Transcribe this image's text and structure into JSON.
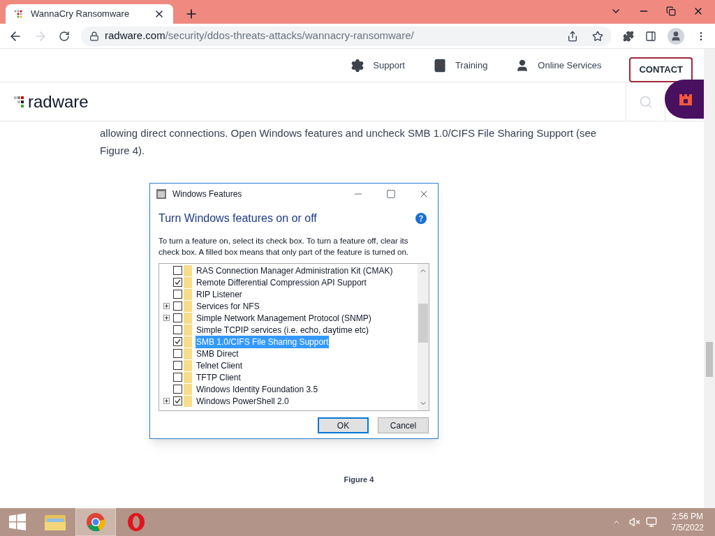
{
  "browser": {
    "tab": {
      "title": "WannaCry Ransomware"
    },
    "address": {
      "domain": "radware.com",
      "path": "/security/ddos-threats-attacks/wannacry-ransomware/"
    }
  },
  "site": {
    "nav": [
      {
        "kind": "gear",
        "label": "Support"
      },
      {
        "kind": "book",
        "label": "Training"
      },
      {
        "kind": "person",
        "label": "Online Services"
      }
    ],
    "contact": "CONTACT",
    "logo": "radware",
    "paragraph": "allowing direct connections. Open Windows features and uncheck SMB 1.0/CIFS File Sharing Support (see Figure 4).",
    "caption": "Figure 4"
  },
  "dialog": {
    "title": "Windows Features",
    "heading": "Turn Windows features on or off",
    "description": "To turn a feature on, select its check box. To turn a feature off, clear its check box. A filled box means that only part of the feature is turned on.",
    "features": [
      {
        "label": "RAS Connection Manager Administration Kit (CMAK)",
        "expandable": false,
        "checked": false,
        "selected": false
      },
      {
        "label": "Remote Differential Compression API Support",
        "expandable": false,
        "checked": true,
        "selected": false
      },
      {
        "label": "RIP Listener",
        "expandable": false,
        "checked": false,
        "selected": false
      },
      {
        "label": "Services for NFS",
        "expandable": true,
        "checked": false,
        "selected": false
      },
      {
        "label": "Simple Network Management Protocol (SNMP)",
        "expandable": true,
        "checked": false,
        "selected": false
      },
      {
        "label": "Simple TCPIP services (i.e. echo, daytime etc)",
        "expandable": false,
        "checked": false,
        "selected": false
      },
      {
        "label": "SMB 1.0/CIFS File Sharing Support",
        "expandable": false,
        "checked": true,
        "selected": true
      },
      {
        "label": "SMB Direct",
        "expandable": false,
        "checked": false,
        "selected": false
      },
      {
        "label": "Telnet Client",
        "expandable": false,
        "checked": false,
        "selected": false
      },
      {
        "label": "TFTP Client",
        "expandable": false,
        "checked": false,
        "selected": false
      },
      {
        "label": "Windows Identity Foundation 3.5",
        "expandable": false,
        "checked": false,
        "selected": false
      },
      {
        "label": "Windows PowerShell 2.0",
        "expandable": true,
        "checked": true,
        "selected": false
      }
    ],
    "buttons": [
      {
        "label": "OK",
        "default": true
      },
      {
        "label": "Cancel",
        "default": false
      }
    ]
  },
  "taskbar": {
    "apps": [
      {
        "kind": "folder",
        "selected": false
      },
      {
        "kind": "chrome",
        "selected": true
      },
      {
        "kind": "opera",
        "selected": false
      }
    ],
    "time": "2:56 PM",
    "date": "7/5/2022"
  }
}
